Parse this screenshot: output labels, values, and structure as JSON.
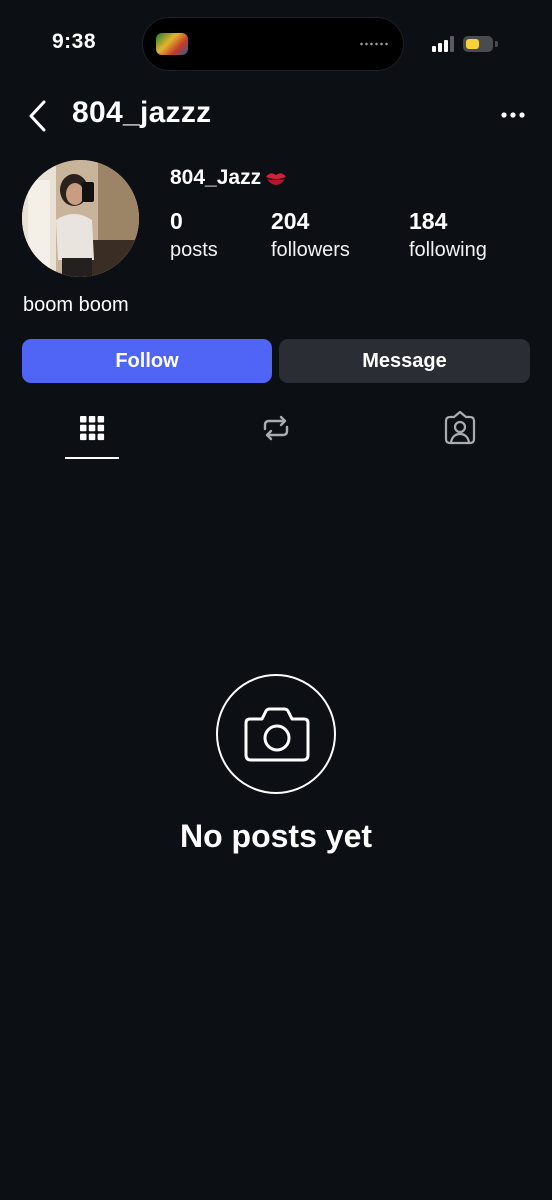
{
  "status_bar": {
    "time": "9:38",
    "signal_bars_active": 3,
    "signal_bars_total": 4,
    "battery_level": 0.55,
    "battery_color": "#f7d33a"
  },
  "header": {
    "back_icon": "chevron-left-icon",
    "username": "804_jazzz",
    "more_icon": "more-horizontal-icon"
  },
  "profile": {
    "display_name": "804_Jazz",
    "name_emoji": "kiss-mark-icon",
    "stats": [
      {
        "count": "0",
        "label": "posts"
      },
      {
        "count": "204",
        "label": "followers"
      },
      {
        "count": "184",
        "label": "following"
      }
    ],
    "bio": "boom boom"
  },
  "actions": {
    "follow_label": "Follow",
    "message_label": "Message",
    "follow_color": "#5064f6",
    "message_color": "#2a2d33"
  },
  "tabs": [
    {
      "icon": "grid-icon",
      "active": true
    },
    {
      "icon": "repost-icon",
      "active": false
    },
    {
      "icon": "tagged-person-icon",
      "active": false
    }
  ],
  "empty_state": {
    "icon": "camera-icon",
    "title": "No posts yet"
  },
  "colors": {
    "background": "#0c1014",
    "text": "#ffffff",
    "inactive_icon": "#a8acb3"
  }
}
